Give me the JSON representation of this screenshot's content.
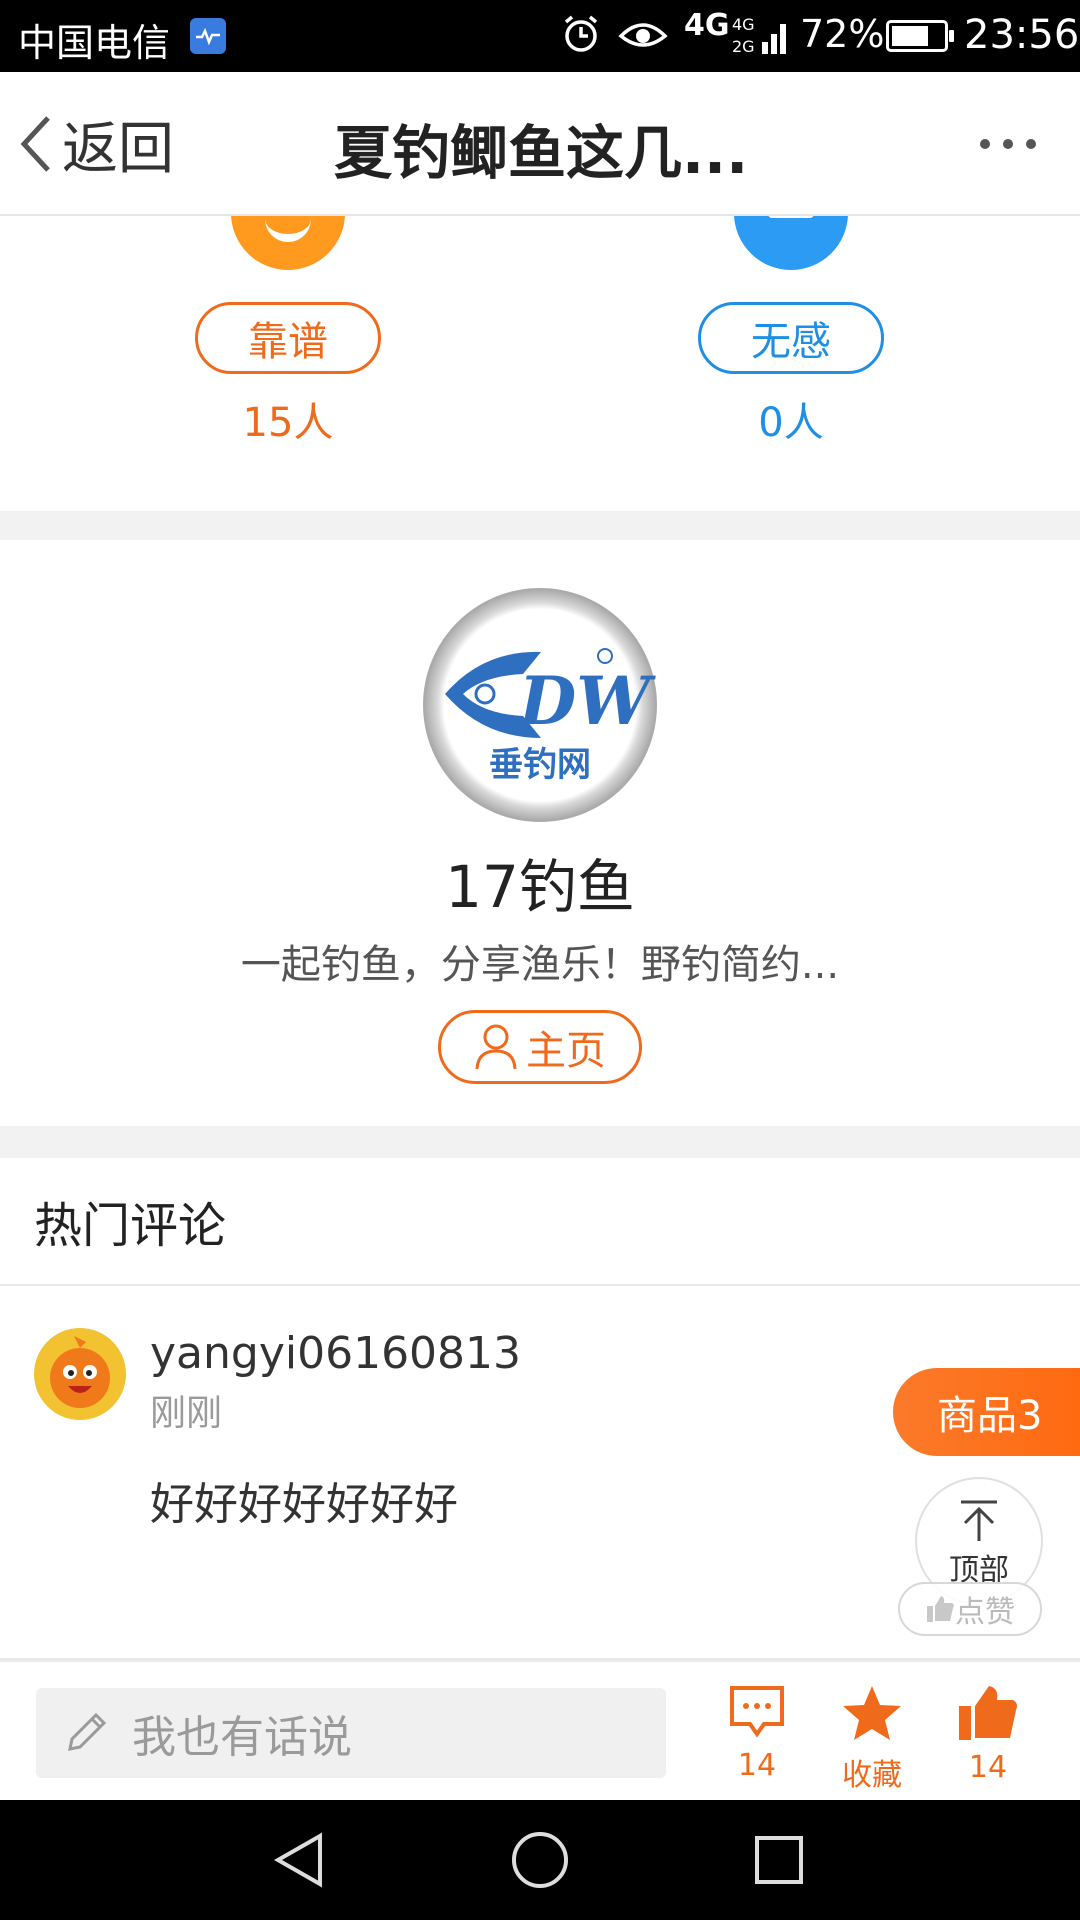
{
  "status_bar": {
    "carrier": "中国电信",
    "network": "4G",
    "battery_pct_label": "72%",
    "battery_level": 0.72,
    "time": "23:56",
    "icons": [
      "health-app-icon",
      "alarm-icon",
      "eye-icon",
      "signal-icon",
      "battery-icon"
    ]
  },
  "nav": {
    "back_label": "返回",
    "title": "夏钓鲫鱼这几...",
    "more_icon": "more-dots-icon"
  },
  "rating": {
    "good": {
      "label": "靠谱",
      "count": "15人",
      "color": "#f06a1c"
    },
    "none": {
      "label": "无感",
      "count": "0人",
      "color": "#1f8fe6"
    }
  },
  "author": {
    "name": "17钓鱼",
    "description": "一起钓鱼，分享渔乐！野钓简约...",
    "home_label": "主页",
    "logo_text": "DW",
    "logo_caption": "垂钓网"
  },
  "comments": {
    "section_title": "热门评论",
    "items": [
      {
        "user": "yangyi06160813",
        "time": "刚刚",
        "text": "好好好好好好好"
      }
    ]
  },
  "floating": {
    "goods_label": "商品3",
    "top_label": "顶部",
    "like_label": "点赞"
  },
  "bottom_bar": {
    "input_placeholder": "我也有话说",
    "comment_count": "14",
    "favorite_label": "收藏",
    "like_count": "14",
    "accent_color": "#f06a1c"
  }
}
